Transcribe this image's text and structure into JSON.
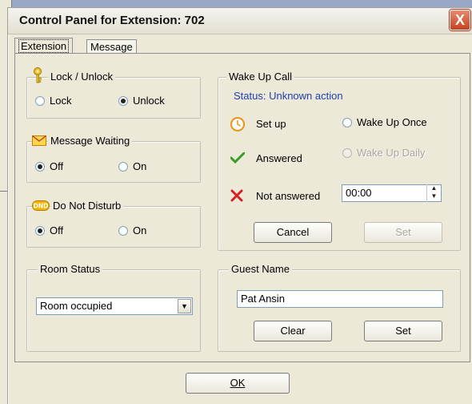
{
  "window": {
    "title": "Control Panel for Extension: 702",
    "close_glyph": "X"
  },
  "tabs": [
    {
      "label": "Extension"
    },
    {
      "label": "Message"
    }
  ],
  "lock": {
    "legend": "Lock / Unlock",
    "options": [
      "Lock",
      "Unlock"
    ],
    "selected": "Unlock",
    "icon": "key-icon"
  },
  "message_waiting": {
    "legend": "Message Waiting",
    "options": [
      "Off",
      "On"
    ],
    "selected": "Off",
    "icon": "envelope-icon"
  },
  "dnd": {
    "legend": "Do Not Disturb",
    "badge": "DND",
    "options": [
      "Off",
      "On"
    ],
    "selected": "Off",
    "icon": "dnd-icon"
  },
  "room_status": {
    "legend": "Room Status",
    "value": "Room occupied"
  },
  "wake_up": {
    "legend": "Wake Up Call",
    "status": "Status: Unknown action",
    "setup_label": "Set up",
    "answered_label": "Answered",
    "not_answered_label": "Not answered",
    "once_label": "Wake Up Once",
    "daily_label": "Wake Up Daily",
    "time_value": "00:00",
    "cancel_label": "Cancel",
    "set_label": "Set",
    "status_color": "#1f3fb0"
  },
  "guest": {
    "legend": "Guest Name",
    "name": "Pat Ansin",
    "clear_label": "Clear",
    "set_label": "Set"
  },
  "ok_label": "OK"
}
